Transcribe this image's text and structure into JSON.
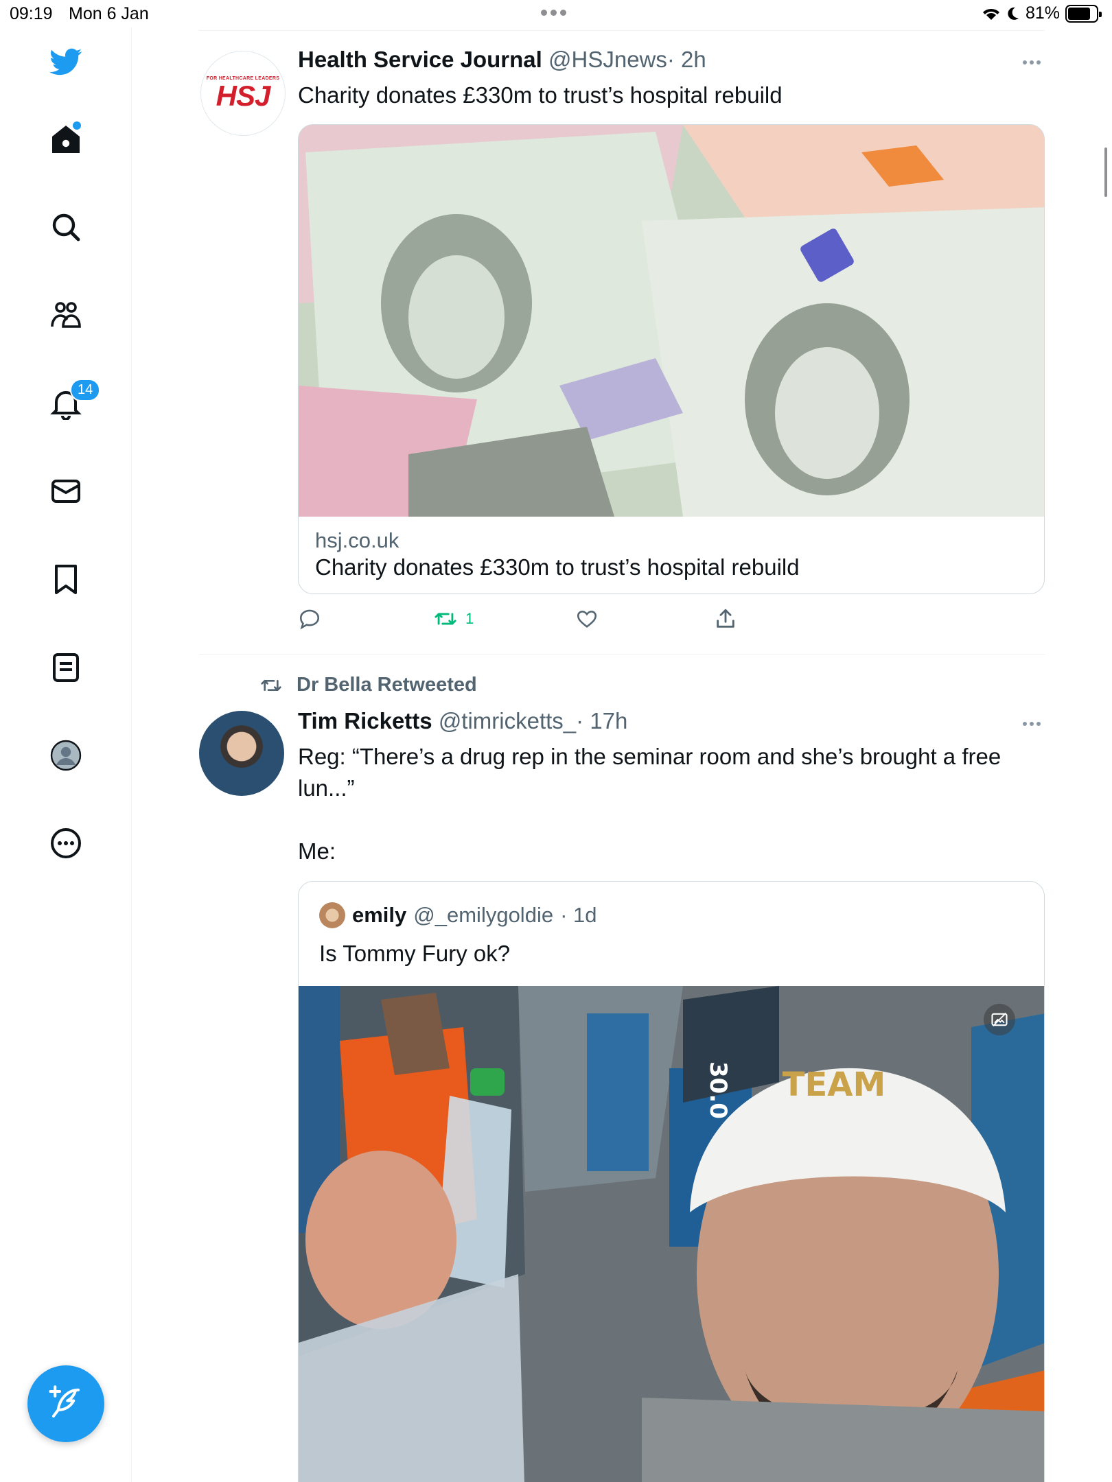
{
  "status_bar": {
    "time": "09:19",
    "date": "Mon 6 Jan",
    "battery": "81%",
    "battery_level": 0.81
  },
  "sidebar": {
    "items": [
      {
        "name": "twitter-logo-icon"
      },
      {
        "name": "home-icon",
        "has_dot": true
      },
      {
        "name": "search-icon"
      },
      {
        "name": "communities-icon"
      },
      {
        "name": "notifications-bell-icon",
        "badge": "14"
      },
      {
        "name": "messages-mail-icon"
      },
      {
        "name": "bookmark-icon"
      },
      {
        "name": "lists-icon"
      },
      {
        "name": "profile-avatar-icon"
      },
      {
        "name": "more-circle-icon"
      }
    ],
    "compose_icon": "compose-feather-icon"
  },
  "tweets": [
    {
      "name": "Health Service Journal",
      "handle": "@HSJnews",
      "time": "· 2h",
      "avatar_small": "FOR HEALTHCARE LEADERS",
      "avatar_logo": "HSJ",
      "text": "Charity donates £330m to trust’s hospital rebuild",
      "card": {
        "domain": "hsj.co.uk",
        "title": "Charity donates £330m to trust’s hospital rebuild"
      },
      "retweet_count": "1"
    },
    {
      "retweeted_by": "Dr Bella Retweeted",
      "name": "Tim Ricketts",
      "handle": "@timricketts_",
      "time": "· 17h",
      "text_line1": "Reg: “There’s a drug rep in the seminar room and she’s brought a free",
      "text_line2": "lun...”",
      "text_line3": "Me:",
      "quote": {
        "name": "emily",
        "handle": "@_emilygoldie",
        "time": "· 1d",
        "text": "Is Tommy Fury ok?",
        "hat_text": "TEAM",
        "bib_text": "30.0"
      }
    }
  ],
  "colors": {
    "accent": "#1d9bf0",
    "retweet_green": "#00ba7c",
    "hsj_red": "#d21f2b"
  }
}
